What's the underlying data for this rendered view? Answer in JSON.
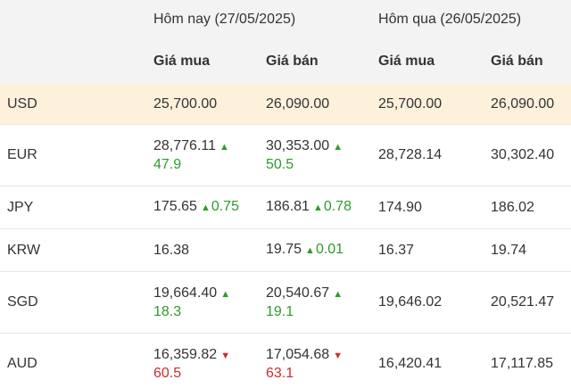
{
  "header": {
    "today_label": "Hôm nay (27/05/2025)",
    "yesterday_label": "Hôm qua (26/05/2025)",
    "buy_label": "Giá mua",
    "sell_label": "Giá bán"
  },
  "rows": [
    {
      "code": "USD",
      "today_buy": "25,700.00",
      "today_buy_change": "",
      "today_buy_dir": "",
      "today_sell": "26,090.00",
      "today_sell_change": "",
      "today_sell_dir": "",
      "yesterday_buy": "25,700.00",
      "yesterday_sell": "26,090.00"
    },
    {
      "code": "EUR",
      "today_buy": "28,776.11",
      "today_buy_change": "47.9",
      "today_buy_dir": "up",
      "today_sell": "30,353.00",
      "today_sell_change": "50.5",
      "today_sell_dir": "up",
      "yesterday_buy": "28,728.14",
      "yesterday_sell": "30,302.40"
    },
    {
      "code": "JPY",
      "today_buy": "175.65",
      "today_buy_change": "0.75",
      "today_buy_dir": "up",
      "today_sell": "186.81",
      "today_sell_change": "0.78",
      "today_sell_dir": "up",
      "yesterday_buy": "174.90",
      "yesterday_sell": "186.02"
    },
    {
      "code": "KRW",
      "today_buy": "16.38",
      "today_buy_change": "",
      "today_buy_dir": "",
      "today_sell": "19.75",
      "today_sell_change": "0.01",
      "today_sell_dir": "up",
      "yesterday_buy": "16.37",
      "yesterday_sell": "19.74"
    },
    {
      "code": "SGD",
      "today_buy": "19,664.40",
      "today_buy_change": "18.3",
      "today_buy_dir": "up",
      "today_sell": "20,540.67",
      "today_sell_change": "19.1",
      "today_sell_dir": "up",
      "yesterday_buy": "19,646.02",
      "yesterday_sell": "20,521.47"
    },
    {
      "code": "AUD",
      "today_buy": "16,359.82",
      "today_buy_change": "60.5",
      "today_buy_dir": "down",
      "today_sell": "17,054.68",
      "today_sell_change": "63.1",
      "today_sell_dir": "down",
      "yesterday_buy": "16,420.41",
      "yesterday_sell": "17,117.85"
    }
  ],
  "icons": {
    "up": "triangle-up-icon",
    "down": "triangle-down-icon"
  },
  "colors": {
    "up": "#2e9a2e",
    "down": "#d42a2a",
    "highlight_row": "#fdf1db",
    "header_bg": "#f3f3f3"
  }
}
